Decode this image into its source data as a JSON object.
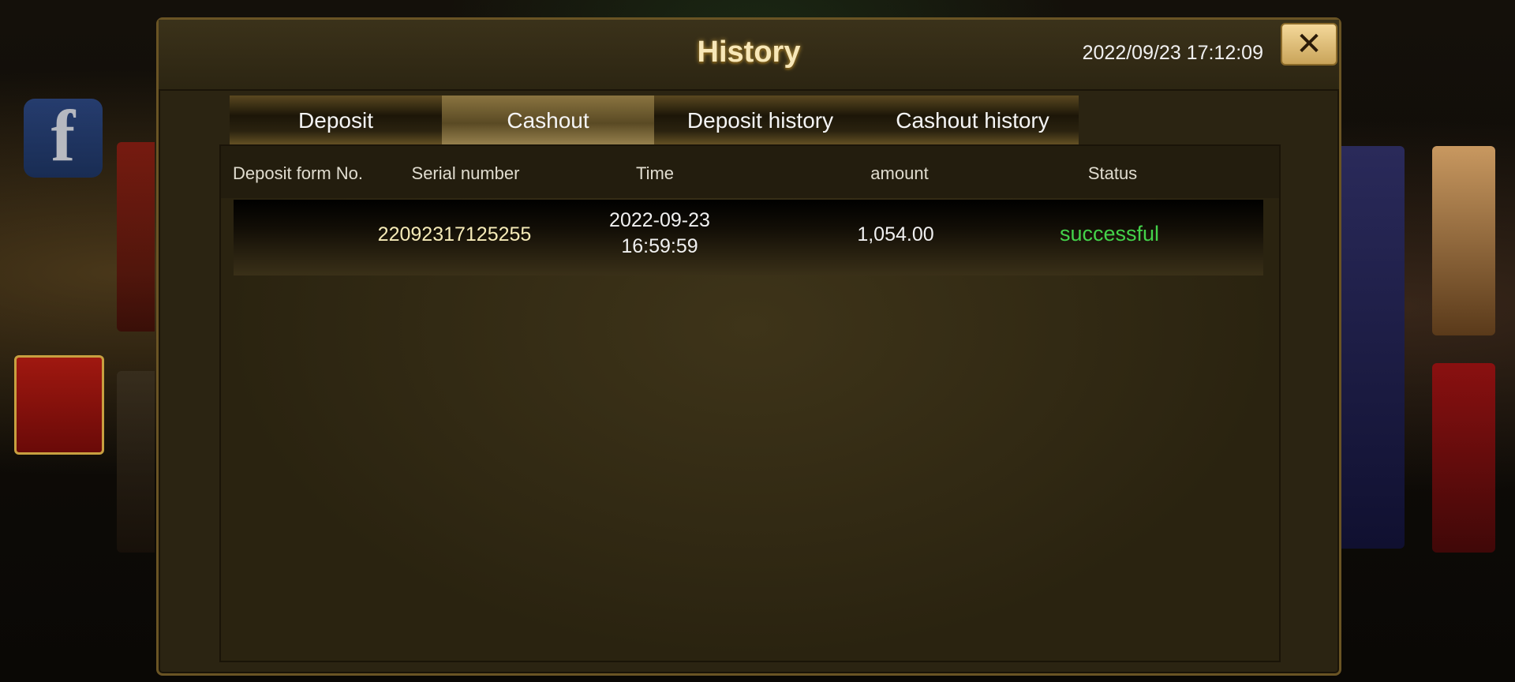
{
  "modal": {
    "title": "History",
    "datetime": "2022/09/23 17:12:09",
    "close_label": "✕"
  },
  "tabs": [
    {
      "label": "Deposit",
      "active": false
    },
    {
      "label": "Cashout",
      "active": true
    },
    {
      "label": "Deposit history",
      "active": false
    },
    {
      "label": "Cashout history",
      "active": false
    }
  ],
  "table": {
    "headers": [
      "Deposit form No.",
      "Serial number",
      "Time",
      "amount",
      "Status"
    ],
    "rows": [
      {
        "deposit_form_no": "",
        "serial_number": "22092317125255",
        "time_date": "2022-09-23",
        "time_clock": "16:59:59",
        "amount": "1,054.00",
        "status": "successful"
      }
    ]
  },
  "background": {
    "facebook_icon": "f",
    "icon_names": [
      "facebook-icon"
    ]
  },
  "colors": {
    "status_success": "#44d24a",
    "title_gold": "#f7e7b8",
    "close_button": "#e8c880"
  }
}
